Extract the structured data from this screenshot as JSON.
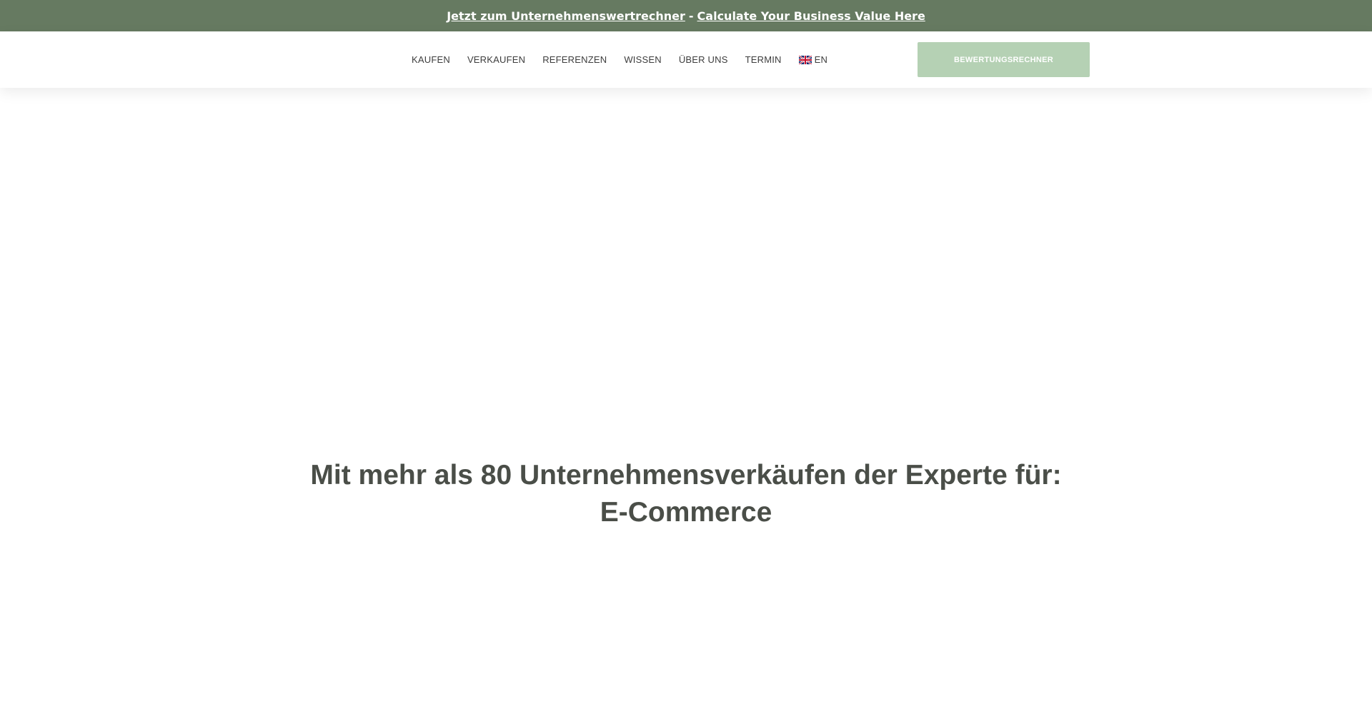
{
  "announcement": {
    "link_de": "Jetzt zum Unternehmenswertrechner",
    "separator": "-",
    "link_en": "Calculate Your Business Value Here"
  },
  "nav": {
    "items": [
      {
        "label": "KAUFEN"
      },
      {
        "label": "VERKAUFEN"
      },
      {
        "label": "REFERENZEN"
      },
      {
        "label": "WISSEN"
      },
      {
        "label": "ÜBER UNS"
      },
      {
        "label": "TERMIN"
      }
    ],
    "language": {
      "icon": "uk-flag-icon",
      "label": "EN"
    }
  },
  "cta": {
    "label": "BEWERTUNGSRECHNER"
  },
  "hero": {
    "line1": "Mit mehr als 80 Unternehmensverkäufen der Experte für:",
    "line2": "E-Commerce"
  },
  "colors": {
    "announcement_bg": "#667a61",
    "cta_bg": "#b5d1b4",
    "heading_text": "#4a4e48",
    "nav_text": "#3d3d3d"
  }
}
